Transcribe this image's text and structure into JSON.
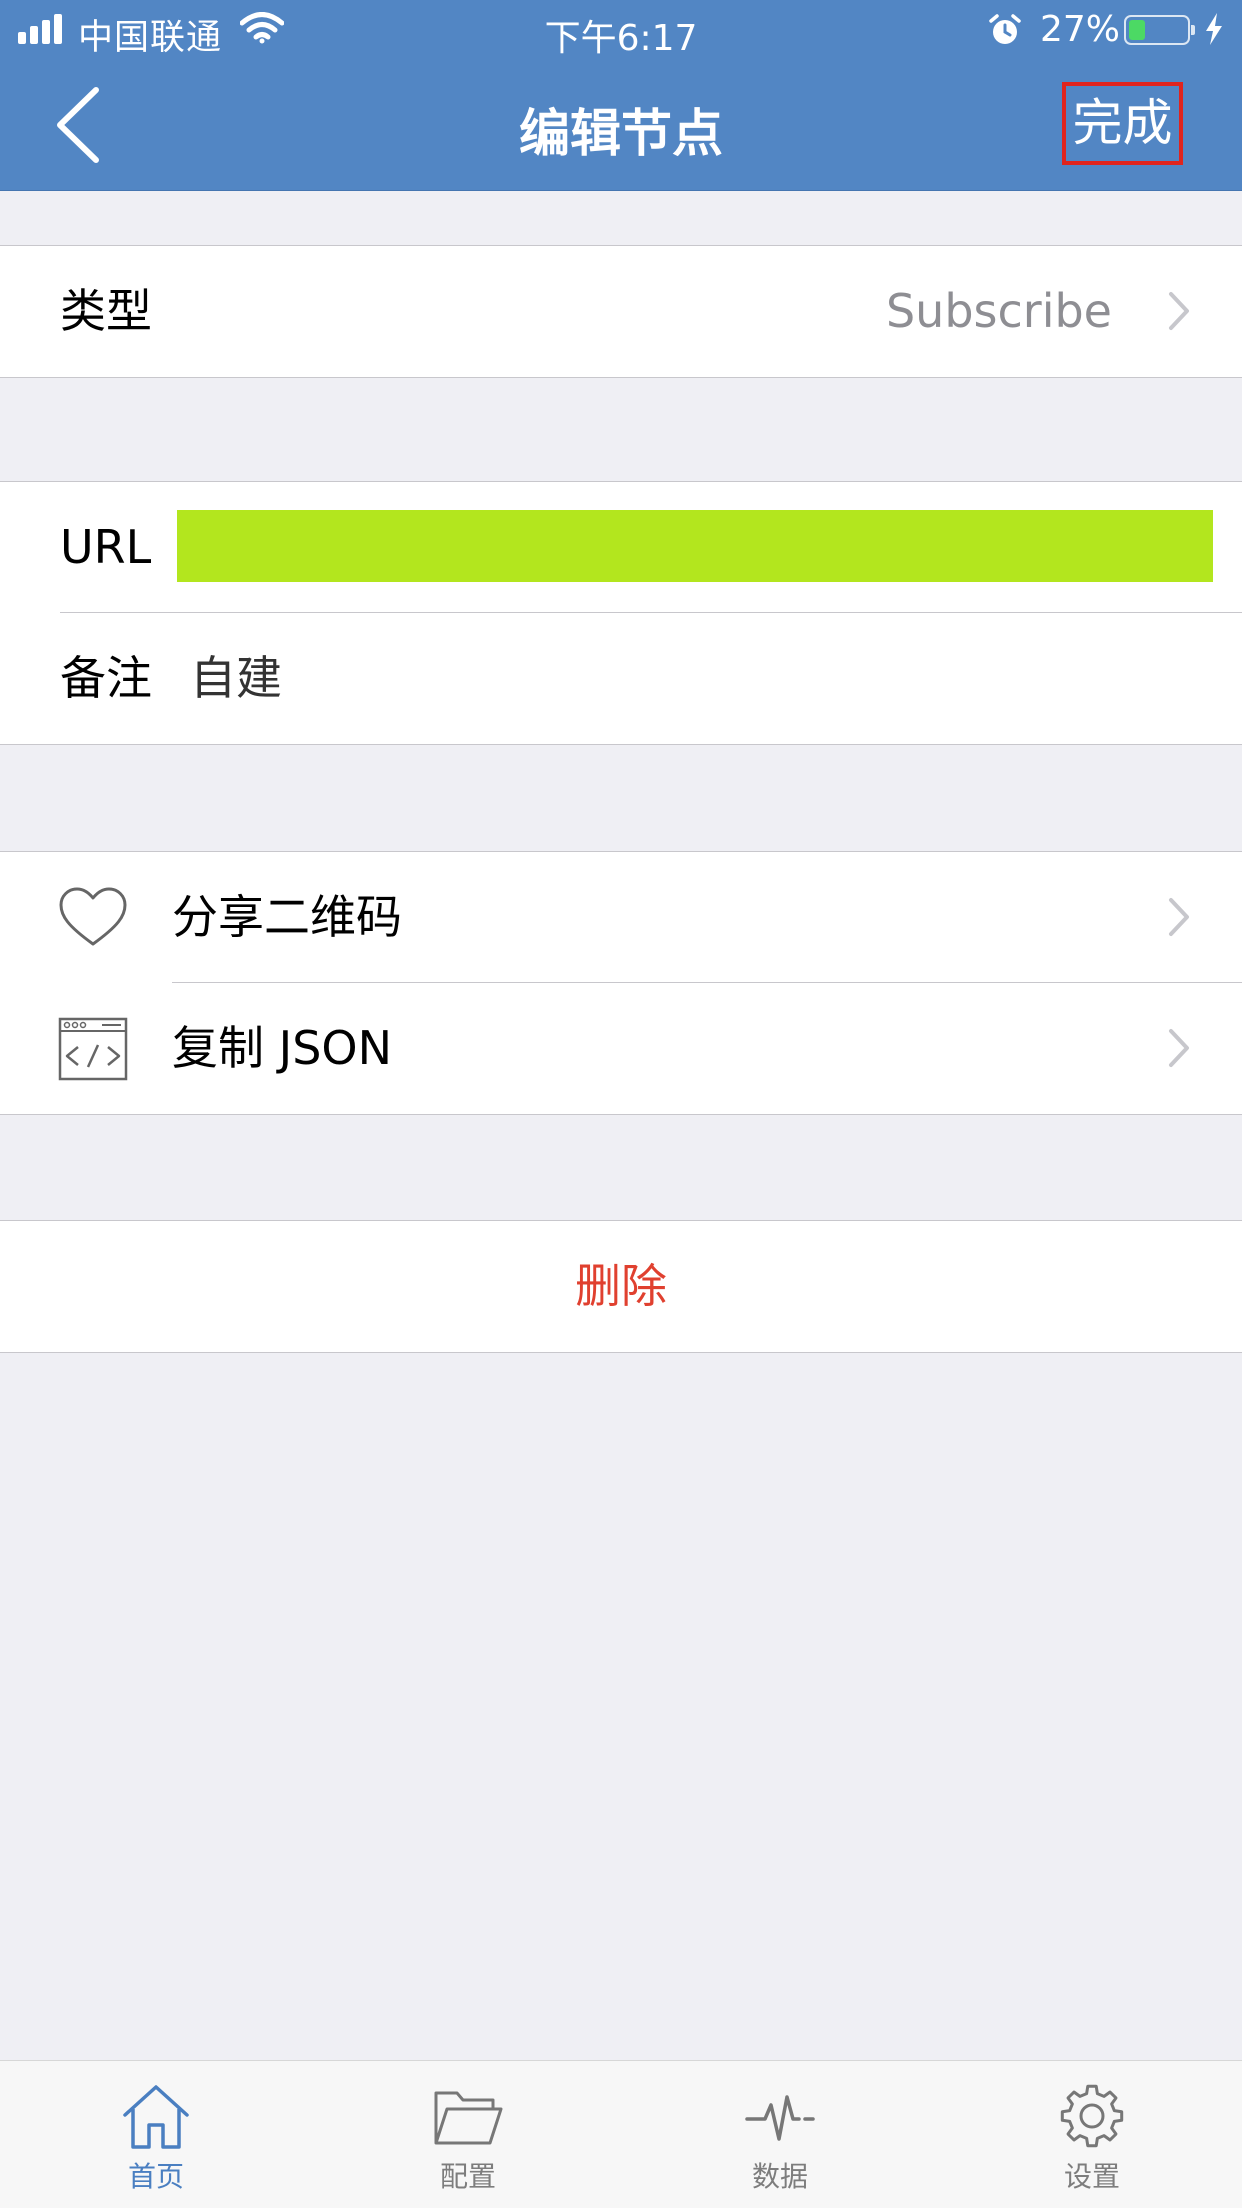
{
  "status_bar": {
    "carrier": "中国联通",
    "time": "下午6:17",
    "battery_percent_label": "27%",
    "battery_level": 0.27
  },
  "nav": {
    "back_icon": "chevron-left-icon",
    "title": "编辑节点",
    "done_label": "完成"
  },
  "type_row": {
    "label": "类型",
    "value": "Subscribe"
  },
  "url_row": {
    "label": "URL",
    "value": ""
  },
  "remark_row": {
    "label": "备注",
    "value": "自建"
  },
  "share_row": {
    "icon": "heart-icon",
    "label": "分享二维码"
  },
  "copy_row": {
    "icon": "code-window-icon",
    "label": "复制 JSON"
  },
  "delete_label": "删除",
  "tabbar": {
    "items": [
      {
        "label": "首页",
        "icon": "home-icon",
        "active": true
      },
      {
        "label": "配置",
        "icon": "folder-icon",
        "active": false
      },
      {
        "label": "数据",
        "icon": "pulse-icon",
        "active": false
      },
      {
        "label": "设置",
        "icon": "gear-icon",
        "active": false
      }
    ]
  },
  "colors": {
    "nav_background": "#5286c4",
    "accent": "#4a7fc1",
    "danger": "#e0402f",
    "url_highlight": "#b3e61e",
    "done_outline": "#e0241e"
  }
}
